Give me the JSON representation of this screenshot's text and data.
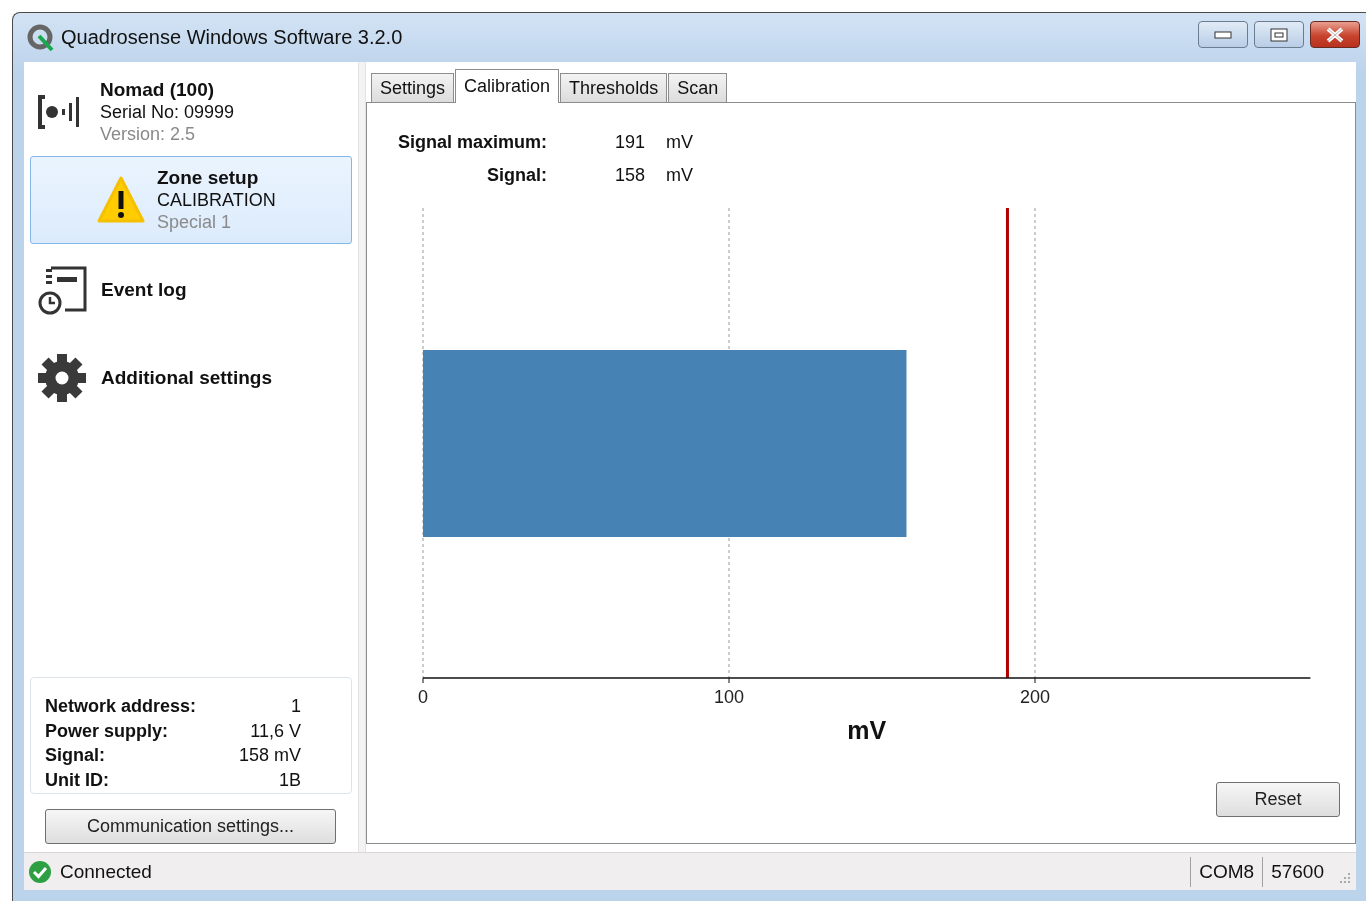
{
  "window": {
    "title": "Quadrosense Windows Software 3.2.0"
  },
  "device": {
    "name": "Nomad (100)",
    "serial": "Serial No: 09999",
    "version": "Version: 2.5"
  },
  "nav": [
    {
      "kind": "zone",
      "title": "Zone setup",
      "subtitle": "CALIBRATION",
      "detail": "Special 1",
      "selected": true
    },
    {
      "kind": "log",
      "title": "Event log",
      "selected": false
    },
    {
      "kind": "settings",
      "title": "Additional settings",
      "selected": false
    }
  ],
  "info": [
    {
      "label": "Network address:",
      "value": "1"
    },
    {
      "label": "Power supply:",
      "value": "11,6 V"
    },
    {
      "label": "Signal:",
      "value": "158 mV"
    },
    {
      "label": "Unit ID:",
      "value": "1B"
    }
  ],
  "communication_button": "Communication settings...",
  "tabs": [
    {
      "label": "Settings",
      "selected": false
    },
    {
      "label": "Calibration",
      "selected": true
    },
    {
      "label": "Thresholds",
      "selected": false
    },
    {
      "label": "Scan",
      "selected": false
    }
  ],
  "readings": [
    {
      "label": "Signal maximum:",
      "value": "191",
      "unit": "mV"
    },
    {
      "label": "Signal:",
      "value": "158",
      "unit": "mV"
    }
  ],
  "chart_data": {
    "type": "bar",
    "orientation": "horizontal",
    "xlabel": "mV",
    "values": [
      158
    ],
    "xlim": [
      0,
      290
    ],
    "xticks": [
      0,
      100,
      200
    ],
    "ref_lines": [
      {
        "axis": "x",
        "value": 191,
        "color": "#b00000"
      }
    ]
  },
  "reset_button": "Reset",
  "status_bar": {
    "status": "Connected",
    "port": "COM8",
    "baud": "57600"
  }
}
